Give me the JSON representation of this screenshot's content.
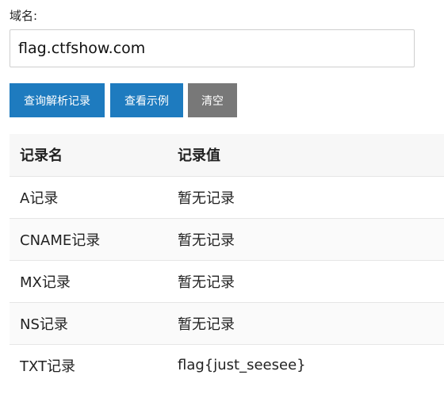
{
  "form": {
    "label": "域名:",
    "domain_value": "flag.ctfshow.com"
  },
  "buttons": {
    "query": "查询解析记录",
    "example": "查看示例",
    "clear": "清空"
  },
  "colors": {
    "primary": "#1e7bbf",
    "gray": "#787878"
  },
  "table": {
    "headers": [
      "记录名",
      "记录值"
    ],
    "rows": [
      [
        "A记录",
        "暂无记录"
      ],
      [
        "CNAME记录",
        "暂无记录"
      ],
      [
        "MX记录",
        "暂无记录"
      ],
      [
        "NS记录",
        "暂无记录"
      ],
      [
        "TXT记录",
        "flag{just_seesee}"
      ]
    ]
  }
}
